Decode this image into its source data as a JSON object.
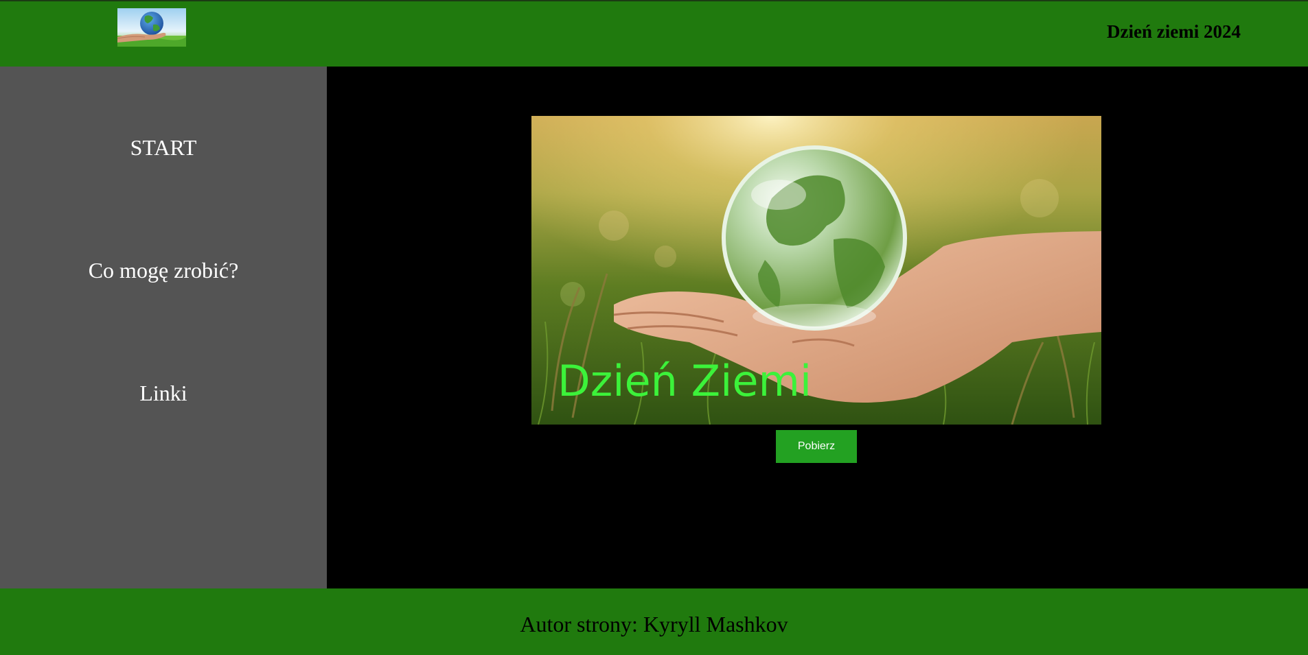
{
  "header": {
    "title": "Dzień ziemi 2024",
    "logo_icon": "earth-in-hand-icon"
  },
  "sidebar": {
    "items": [
      {
        "label": "START"
      },
      {
        "label": "Co mogę zrobić?"
      },
      {
        "label": "Linki"
      }
    ]
  },
  "main": {
    "hero_caption": "Dzień Ziemi",
    "hero_image": "glass-globe-in-hand-over-grass",
    "download_label": "Pobierz"
  },
  "footer": {
    "author": "Autor strony: Kyryll Mashkov"
  },
  "colors": {
    "header_bg": "#207a0e",
    "sidebar_bg": "#545454",
    "main_bg": "#000000",
    "caption": "#3cf23a",
    "button_bg": "#23a122"
  }
}
